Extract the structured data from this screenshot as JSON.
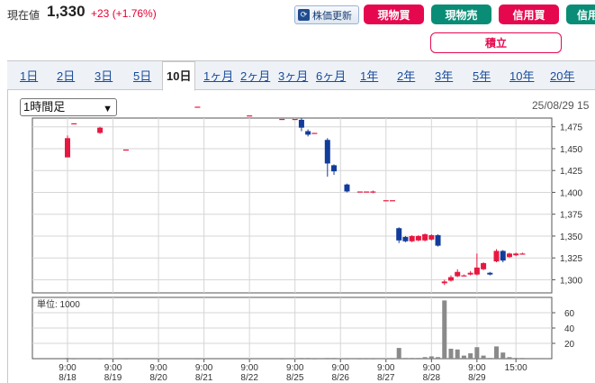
{
  "quote": {
    "label": "現在値",
    "price": "1,330",
    "change": "+23 (+1.76%)"
  },
  "actions": {
    "refresh_label": "株価更新",
    "genbutsu_buy": "現物買",
    "genbutsu_sell": "現物売",
    "shinyo_buy": "信用買",
    "shinyo_cut": "信用",
    "tsumitate": "積立"
  },
  "tabs": [
    {
      "label": "1日"
    },
    {
      "label": "2日"
    },
    {
      "label": "3日"
    },
    {
      "label": "5日"
    },
    {
      "label": "10日",
      "active": true
    },
    {
      "label": "1ヶ月"
    },
    {
      "label": "2ヶ月"
    },
    {
      "label": "3ヶ月"
    },
    {
      "label": "6ヶ月"
    },
    {
      "label": "1年"
    },
    {
      "label": "2年"
    },
    {
      "label": "3年"
    },
    {
      "label": "5年"
    },
    {
      "label": "10年"
    },
    {
      "label": "20年"
    }
  ],
  "period_select": {
    "value": "1時間足"
  },
  "chart_date": "25/08/29 15",
  "colors": {
    "up": "#e8173f",
    "down": "#123c9a",
    "volume": "#8a8a8a"
  },
  "chart_data": [
    {
      "type": "candlestick",
      "ylim": [
        1285,
        1485
      ],
      "y_ticks": [
        "1,475",
        "1,450",
        "1,425",
        "1,400",
        "1,375",
        "1,350",
        "1,325",
        "1,300"
      ],
      "y_tick_values": [
        1475,
        1450,
        1425,
        1400,
        1375,
        1350,
        1325,
        1300
      ],
      "x_tick_labels": [
        [
          "9:00",
          "8/18"
        ],
        [
          "9:00",
          "8/19"
        ],
        [
          "9:00",
          "8/20"
        ],
        [
          "9:00",
          "8/21"
        ],
        [
          "9:00",
          "8/22"
        ],
        [
          "9:00",
          "8/25"
        ],
        [
          "9:00",
          "8/26"
        ],
        [
          "9:00",
          "8/27"
        ],
        [
          "9:00",
          "8/28"
        ],
        [
          "9:00",
          "8/29"
        ],
        [
          "15:00",
          ""
        ]
      ],
      "x_tick_index": [
        0,
        7,
        14,
        21,
        28,
        35,
        42,
        49,
        56,
        63,
        69
      ],
      "candles": [
        [
          0,
          1440,
          1462,
          1442,
          1465
        ],
        [
          1,
          1479,
          1479,
          1479,
          1479
        ],
        [
          5,
          1468,
          1474,
          1467,
          1475
        ],
        [
          9,
          1449,
          1449,
          1449,
          1449
        ],
        [
          20,
          1498,
          1498,
          1498,
          1498
        ],
        [
          28,
          1488,
          1488,
          1488,
          1488
        ],
        [
          33,
          1484,
          1484,
          1484,
          1484
        ],
        [
          35,
          1484,
          1484,
          1484,
          1484
        ],
        [
          36,
          1483,
          1474,
          1470,
          1485
        ],
        [
          37,
          1470,
          1466,
          1464,
          1472
        ],
        [
          38,
          1468,
          1468,
          1468,
          1468
        ],
        [
          40,
          1460,
          1433,
          1418,
          1462
        ],
        [
          41,
          1431,
          1424,
          1420,
          1432
        ],
        [
          43,
          1409,
          1401,
          1400,
          1410
        ],
        [
          45,
          1401,
          1401,
          1401,
          1401
        ],
        [
          46,
          1401,
          1401,
          1401,
          1401
        ],
        [
          47,
          1400,
          1401,
          1399,
          1402
        ],
        [
          49,
          1391,
          1391,
          1391,
          1391
        ],
        [
          50,
          1391,
          1391,
          1391,
          1391
        ],
        [
          51,
          1359,
          1345,
          1342,
          1360
        ],
        [
          52,
          1349,
          1344,
          1343,
          1350
        ],
        [
          53,
          1344,
          1350,
          1343,
          1351
        ],
        [
          54,
          1345,
          1350,
          1344,
          1351
        ],
        [
          55,
          1345,
          1352,
          1344,
          1353
        ],
        [
          56,
          1346,
          1351,
          1345,
          1352
        ],
        [
          57,
          1351,
          1339,
          1338,
          1352
        ],
        [
          58,
          1296,
          1298,
          1294,
          1300
        ],
        [
          59,
          1299,
          1303,
          1298,
          1305
        ],
        [
          60,
          1304,
          1309,
          1303,
          1312
        ],
        [
          61,
          1305,
          1305,
          1304,
          1306
        ],
        [
          62,
          1306,
          1308,
          1305,
          1310
        ],
        [
          63,
          1306,
          1314,
          1305,
          1330
        ],
        [
          64,
          1312,
          1319,
          1311,
          1320
        ],
        [
          65,
          1308,
          1306,
          1305,
          1309
        ],
        [
          66,
          1321,
          1333,
          1320,
          1335
        ],
        [
          67,
          1333,
          1322,
          1320,
          1334
        ],
        [
          68,
          1326,
          1330,
          1325,
          1331
        ],
        [
          69,
          1328,
          1330,
          1327,
          1331
        ],
        [
          70,
          1330,
          1330,
          1329,
          1331
        ]
      ]
    },
    {
      "type": "bar",
      "title": "単位: 1000",
      "ylim": [
        0,
        80
      ],
      "y_ticks": [
        "60",
        "40",
        "20"
      ],
      "y_tick_values": [
        60,
        40,
        20
      ],
      "values": [
        [
          0,
          1
        ],
        [
          1,
          0
        ],
        [
          5,
          0
        ],
        [
          9,
          0
        ],
        [
          20,
          0
        ],
        [
          28,
          0
        ],
        [
          33,
          0
        ],
        [
          35,
          0
        ],
        [
          36,
          1
        ],
        [
          37,
          1
        ],
        [
          38,
          0
        ],
        [
          40,
          1
        ],
        [
          41,
          1
        ],
        [
          43,
          0
        ],
        [
          45,
          0
        ],
        [
          46,
          0
        ],
        [
          47,
          0
        ],
        [
          49,
          0
        ],
        [
          50,
          0
        ],
        [
          51,
          14
        ],
        [
          52,
          1
        ],
        [
          53,
          1
        ],
        [
          54,
          1
        ],
        [
          55,
          2
        ],
        [
          56,
          3
        ],
        [
          57,
          2
        ],
        [
          58,
          76
        ],
        [
          59,
          13
        ],
        [
          60,
          12
        ],
        [
          61,
          4
        ],
        [
          62,
          7
        ],
        [
          63,
          15
        ],
        [
          64,
          4
        ],
        [
          65,
          1
        ],
        [
          66,
          16
        ],
        [
          67,
          8
        ],
        [
          68,
          2
        ],
        [
          69,
          1
        ],
        [
          70,
          1
        ]
      ]
    }
  ]
}
